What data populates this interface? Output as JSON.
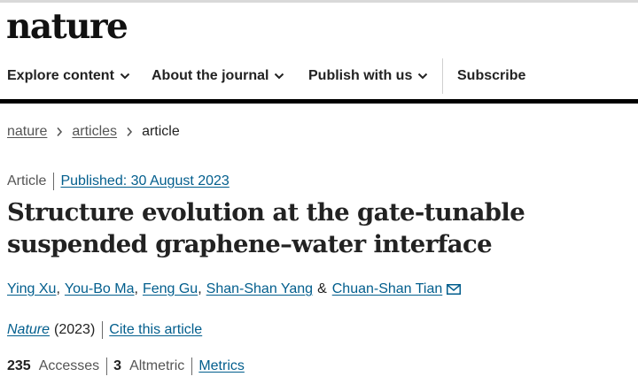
{
  "site": {
    "logo": "nature"
  },
  "nav": {
    "items": [
      {
        "label": "Explore content",
        "has_menu": true
      },
      {
        "label": "About the journal",
        "has_menu": true
      },
      {
        "label": "Publish with us",
        "has_menu": true
      },
      {
        "label": "Subscribe",
        "has_menu": false
      }
    ]
  },
  "breadcrumb": {
    "items": [
      "nature",
      "articles"
    ],
    "current": "article"
  },
  "article": {
    "type": "Article",
    "published": "Published: 30 August 2023",
    "title": "Structure evolution at the gate-tunable suspended graphene–water interface",
    "authors": [
      "Ying Xu",
      "You-Bo Ma",
      "Feng Gu",
      "Shan-Shan Yang",
      "Chuan-Shan Tian"
    ],
    "author_joiner": "&",
    "journal": "Nature",
    "year": "(2023)",
    "cite_label": "Cite this article",
    "accesses_count": "235",
    "accesses_label": "Accesses",
    "altmetric_count": "3",
    "altmetric_label": "Altmetric",
    "metrics_label": "Metrics"
  },
  "colors": {
    "link": "#025e8d",
    "text": "#222222",
    "muted": "#555555"
  },
  "icons": {
    "menu_chevron": "chevron-down-icon",
    "crumb_sep": "chevron-right-icon",
    "corresponding": "email-icon"
  }
}
